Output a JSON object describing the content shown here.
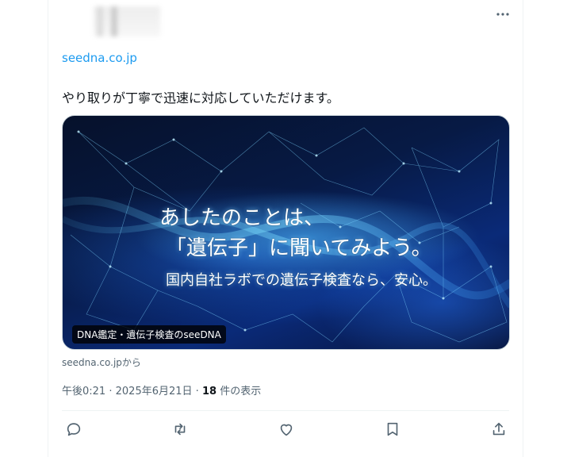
{
  "header": {
    "more_icon": "more-icon"
  },
  "tweet": {
    "link_url": "seedna.co.jp",
    "text": "やり取りが丁寧で迅速に対応していただけます。"
  },
  "card": {
    "headline_line1": "あしたのことは、",
    "headline_line2": "「遺伝子」に聞いてみよう。",
    "headline_line3": "国内自社ラボでの遺伝子検査なら、安心。",
    "label": "DNA鑑定・遺伝子検査のseeDNA",
    "source": "seedna.co.jpから"
  },
  "meta": {
    "time": "午後0:21",
    "separator": "·",
    "date": "2025年6月21日",
    "views_count": "18",
    "views_label": "件の表示"
  },
  "actions": [
    {
      "name": "reply-icon"
    },
    {
      "name": "retweet-icon"
    },
    {
      "name": "like-icon"
    },
    {
      "name": "bookmark-icon"
    },
    {
      "name": "share-icon"
    }
  ],
  "colors": {
    "link": "#1d9bf0",
    "secondary_text": "#536471",
    "primary_text": "#0f1419",
    "card_background": "#0a2a78"
  }
}
